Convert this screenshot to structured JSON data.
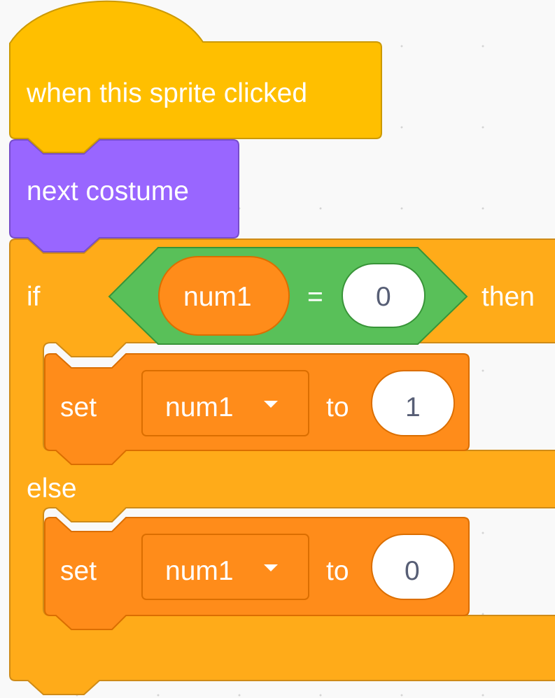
{
  "blocks": {
    "hat": {
      "label": "when this sprite clicked"
    },
    "looks": {
      "label": "next costume"
    },
    "if_else": {
      "if_label": "if",
      "then_label": "then",
      "else_label": "else",
      "condition": {
        "left_reporter": "num1",
        "operator": "=",
        "right_value": "0"
      },
      "then_branch": {
        "keyword": "set",
        "variable": "num1",
        "to_label": "to",
        "value": "1"
      },
      "else_branch": {
        "keyword": "set",
        "variable": "num1",
        "to_label": "to",
        "value": "0"
      }
    }
  },
  "colors": {
    "events": "#ffbf00",
    "events_border": "#cc9900",
    "looks": "#9966ff",
    "looks_border": "#774dcb",
    "control": "#ffab19",
    "control_border": "#cf8b17",
    "operators": "#59c059",
    "operators_border": "#389438",
    "variables": "#ff8c1a",
    "variables_border": "#db6e00",
    "input_text": "#575e75"
  }
}
